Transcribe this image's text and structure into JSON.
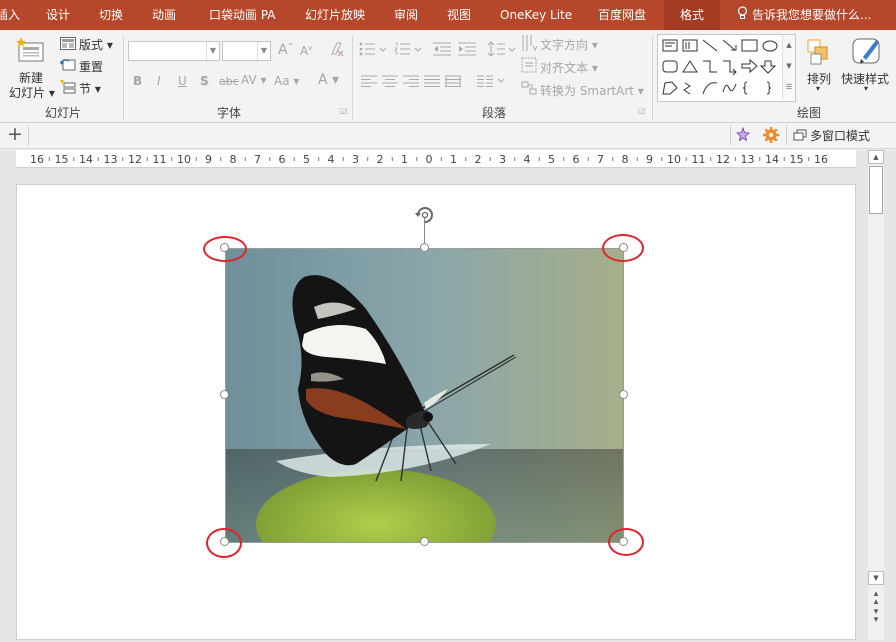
{
  "tabs": [
    {
      "label": "插入"
    },
    {
      "label": "设计"
    },
    {
      "label": "切换"
    },
    {
      "label": "动画"
    },
    {
      "label": "口袋动画 PA"
    },
    {
      "label": "幻灯片放映"
    },
    {
      "label": "审阅"
    },
    {
      "label": "视图"
    },
    {
      "label": "OneKey Lite"
    },
    {
      "label": "百度网盘"
    },
    {
      "label": "格式"
    }
  ],
  "tell_me": "告诉我您想要做什么...",
  "slides_group": {
    "new_slide_line1": "新建",
    "new_slide_line2": "幻灯片",
    "layout": "版式",
    "reset": "重置",
    "section": "节",
    "label": "幻灯片"
  },
  "font_group": {
    "label": "字体",
    "bold": "B",
    "italic": "I",
    "underline": "U",
    "shadow": "S",
    "strike": "abc",
    "spacing": "AV",
    "case": "Aa",
    "color": "A",
    "grow": "A",
    "shrink": "A"
  },
  "paragraph_group": {
    "label": "段落",
    "text_direction": "文字方向",
    "align_text": "对齐文本",
    "smartart": "转换为 SmartArt"
  },
  "drawing_group": {
    "label": "绘图",
    "arrange": "排列",
    "quick_styles": "快速样式"
  },
  "bar2": {
    "add": "+",
    "multiwindow": "多窗口模式"
  },
  "ruler": {
    "labels": [
      "16",
      "15",
      "14",
      "13",
      "12",
      "11",
      "10",
      "9",
      "8",
      "7",
      "6",
      "5",
      "4",
      "3",
      "2",
      "1",
      "0",
      "1",
      "2",
      "3",
      "4",
      "5",
      "6",
      "7",
      "8",
      "9",
      "10",
      "11",
      "12",
      "13",
      "14",
      "15",
      "16"
    ]
  },
  "photo": {
    "subject": "butterfly-on-leaf"
  },
  "colors": {
    "accent": "#b7472a",
    "accent_active": "#a33c22",
    "highlight": "#e0242e"
  }
}
